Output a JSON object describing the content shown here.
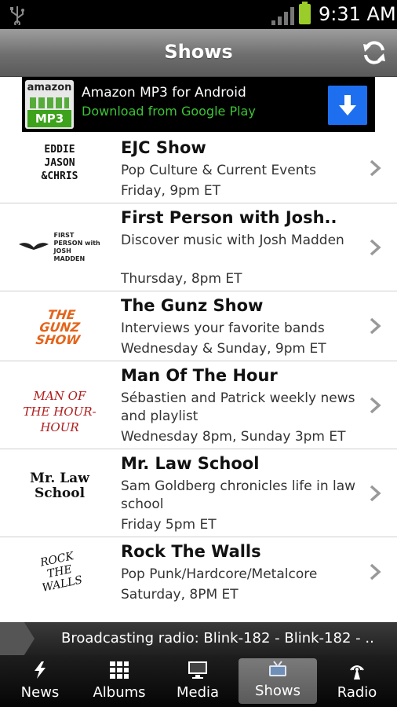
{
  "status_bar": {
    "time": "9:31 AM"
  },
  "header": {
    "title": "Shows"
  },
  "ad": {
    "brand": "amazon",
    "badge": "MP3",
    "title": "Amazon MP3 for Android",
    "subtitle": "Download from Google Play"
  },
  "shows": [
    {
      "name": "EJC Show",
      "description": "Pop Culture & Current Events",
      "schedule": "Friday, 9pm ET",
      "logo_text": "EDDIE JASON &CHRIS"
    },
    {
      "name": "First Person with Josh..",
      "description": "Discover music with Josh Madden",
      "schedule": "Thursday, 8pm ET",
      "logo_text": "FIRST PERSON with JOSH MADDEN"
    },
    {
      "name": "The Gunz Show",
      "description": "Interviews your favorite bands",
      "schedule": "Wednesday & Sunday, 9pm ET",
      "logo_text": "THE GUNZ SHOW"
    },
    {
      "name": "Man Of The Hour",
      "description": "Sébastien and Patrick weekly news and playlist",
      "schedule": "Wednesday 8pm, Sunday 3pm ET",
      "logo_text": "MAN OF THE HOUR-HOUR"
    },
    {
      "name": "Mr. Law School",
      "description": "Sam Goldberg chronicles life in law school",
      "schedule": "Friday 5pm ET",
      "logo_text": "Mr. Law School"
    },
    {
      "name": "Rock The Walls",
      "description": "Pop Punk/Hardcore/Metalcore",
      "schedule": "Saturday, 8PM ET",
      "logo_text": "ROCK THE WALLS"
    }
  ],
  "now_playing": {
    "text": "Broadcasting radio: Blink-182 - Blink-182 - ..."
  },
  "nav": {
    "news": "News",
    "albums": "Albums",
    "media": "Media",
    "shows": "Shows",
    "radio": "Radio"
  },
  "colors": {
    "ad_subtitle": "#3cc436",
    "battery": "#9acd2a",
    "download_button": "#1e6ff0"
  }
}
